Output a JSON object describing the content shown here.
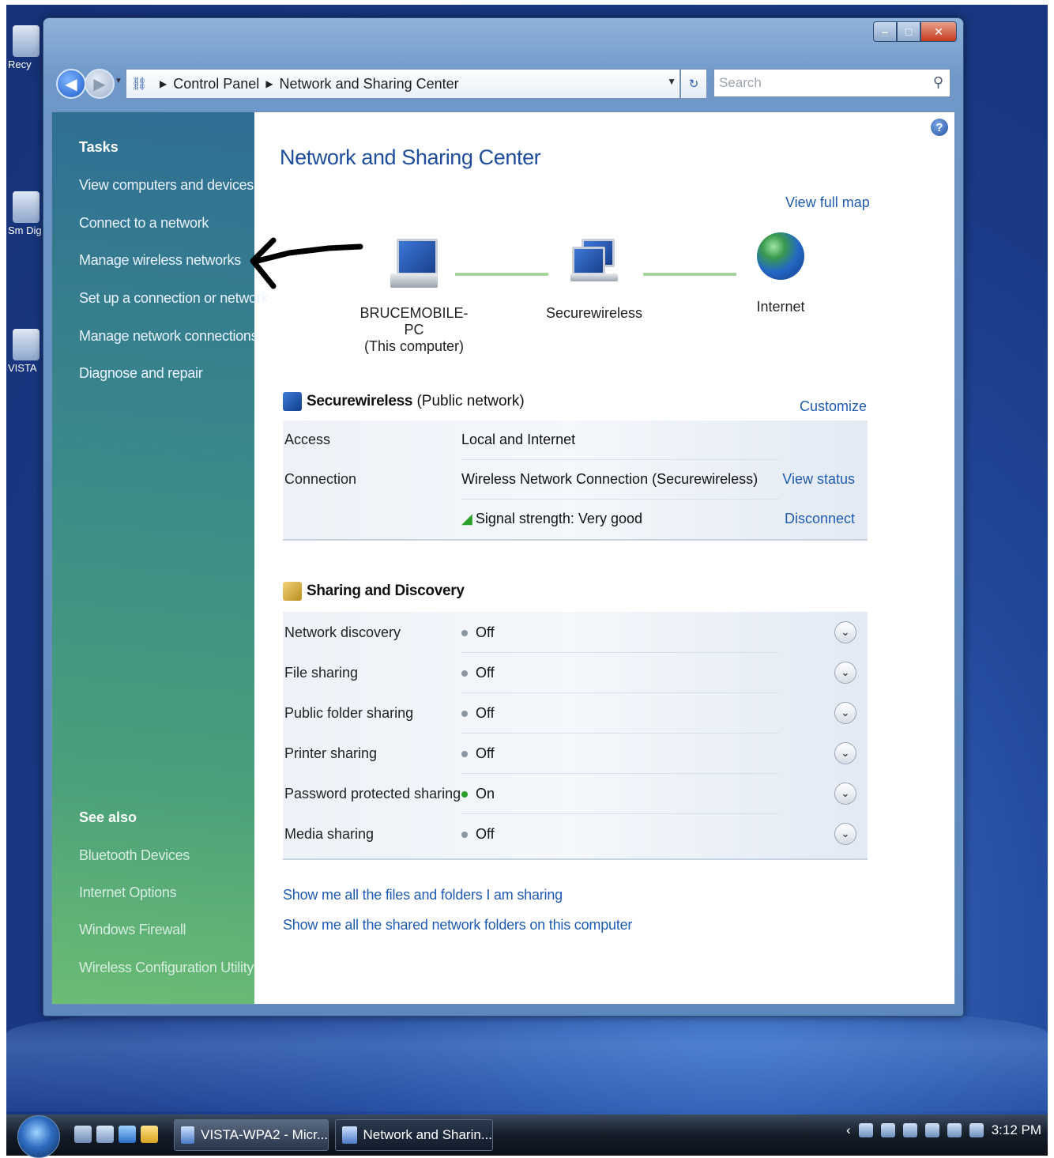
{
  "desktop": {
    "icons": [
      "Recy",
      "Sm Dig",
      "VISTA"
    ]
  },
  "window": {
    "breadcrumb": [
      "Control Panel",
      "Network and Sharing Center"
    ],
    "search_placeholder": "Search"
  },
  "sidebar": {
    "tasks_title": "Tasks",
    "tasks": [
      "View computers and devices",
      "Connect to a network",
      "Manage wireless networks",
      "Set up a connection or network",
      "Manage network connections",
      "Diagnose and repair"
    ],
    "see_also_title": "See also",
    "see_also": [
      "Bluetooth Devices",
      "Internet Options",
      "Windows Firewall",
      "Wireless Configuration Utility"
    ]
  },
  "main": {
    "title": "Network and Sharing Center",
    "view_full_map": "View full map",
    "map": {
      "computer_name": "BRUCEMOBILE-PC",
      "computer_sub": "(This computer)",
      "network_name": "Securewireless",
      "internet_label": "Internet"
    },
    "network": {
      "name": "Securewireless",
      "type": "(Public network)",
      "customize": "Customize",
      "access_label": "Access",
      "access_value": "Local and Internet",
      "connection_label": "Connection",
      "connection_value": "Wireless Network Connection (Securewireless)",
      "view_status": "View status",
      "signal_value": "Signal strength: Very good",
      "disconnect": "Disconnect"
    },
    "sharing": {
      "title": "Sharing and Discovery",
      "rows": [
        {
          "label": "Network discovery",
          "status": "Off"
        },
        {
          "label": "File sharing",
          "status": "Off"
        },
        {
          "label": "Public folder sharing",
          "status": "Off"
        },
        {
          "label": "Printer sharing",
          "status": "Off"
        },
        {
          "label": "Password protected sharing",
          "status": "On"
        },
        {
          "label": "Media sharing",
          "status": "Off"
        }
      ]
    },
    "links": [
      "Show me all the files and folders I am sharing",
      "Show me all the shared network folders on this computer"
    ]
  },
  "taskbar": {
    "buttons": [
      "VISTA-WPA2 - Micr...",
      "Network and Sharin..."
    ],
    "clock": "3:12 PM"
  },
  "colors": {
    "link": "#1f5bb3",
    "title": "#1e4d9c",
    "status_on": "#2aa02a",
    "status_off": "#8c96a0"
  }
}
